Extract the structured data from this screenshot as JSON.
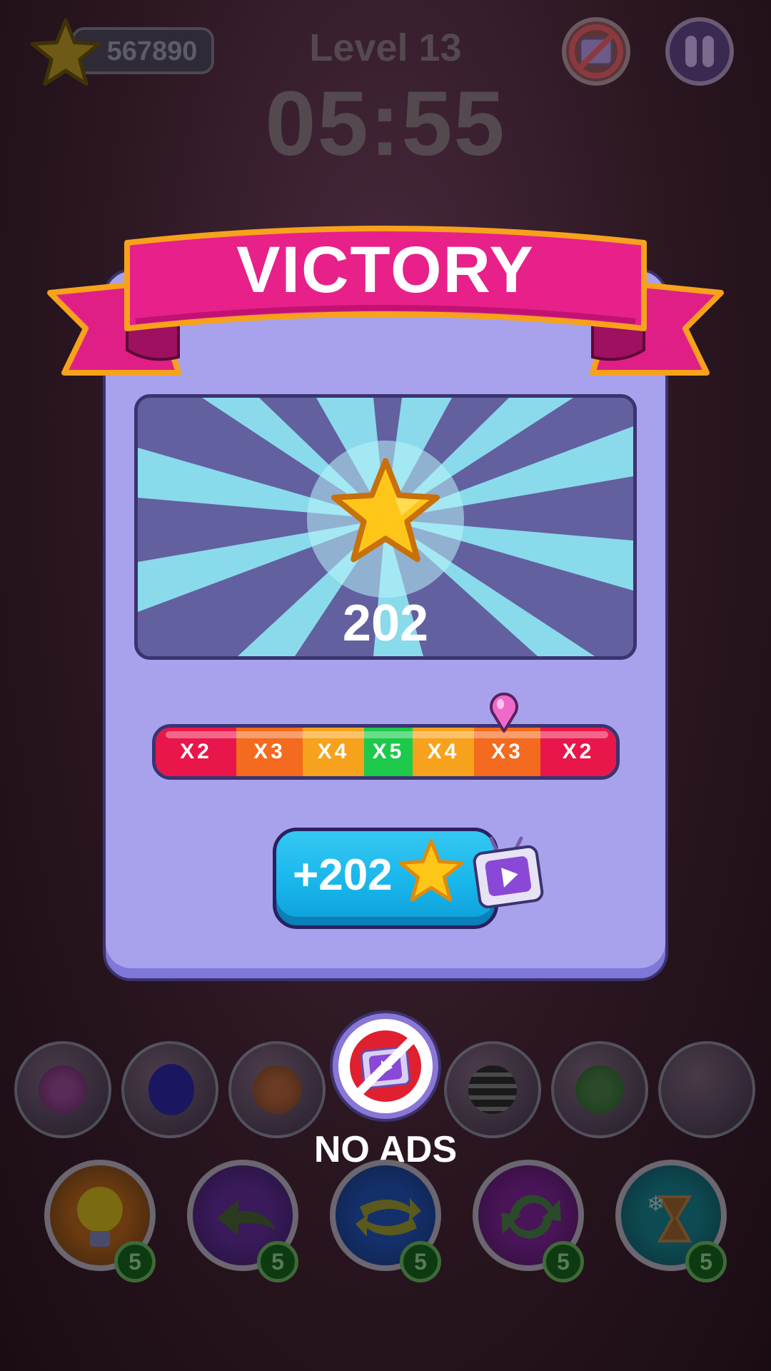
{
  "hud": {
    "coins": "567890",
    "level": "Level 13",
    "timer": "05:55"
  },
  "dialog": {
    "title": "VICTORY",
    "prize_amount": "202",
    "multipliers": [
      {
        "label": "X2",
        "color": "#e8164a"
      },
      {
        "label": "X3",
        "color": "#f46a1e"
      },
      {
        "label": "X4",
        "color": "#f7a21c"
      },
      {
        "label": "X5",
        "color": "#1dc94a"
      },
      {
        "label": "X4",
        "color": "#f7a21c"
      },
      {
        "label": "X3",
        "color": "#f46a1e"
      },
      {
        "label": "X2",
        "color": "#e8164a"
      }
    ],
    "claim_label": "+202"
  },
  "no_ads": {
    "label": "NO ADS"
  },
  "boosters": [
    {
      "name": "hint",
      "count": "5"
    },
    {
      "name": "undo",
      "count": "5"
    },
    {
      "name": "shuffle",
      "count": "5"
    },
    {
      "name": "refresh",
      "count": "5"
    },
    {
      "name": "freeze-time",
      "count": "5"
    }
  ],
  "colors": {
    "panel": "#a8a2ec",
    "ribbon": "#e8208a",
    "claim_button": "#18b6ec",
    "star": "#ffc61a"
  }
}
